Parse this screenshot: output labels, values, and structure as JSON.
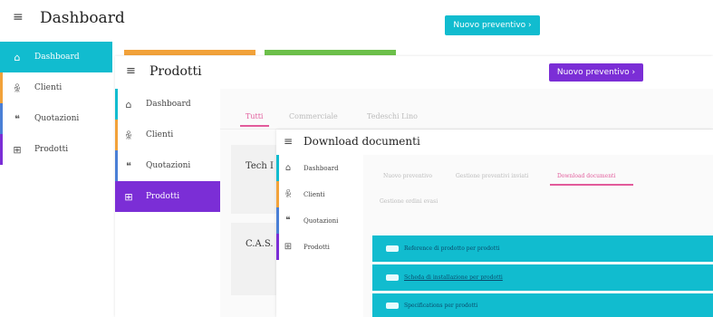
{
  "colors": {
    "teal": "#11bccf",
    "purple": "#7b2ed6",
    "pink": "#e25b9b",
    "orange": "#f2a23a",
    "green": "#6cc04a",
    "bluebar": "#4a7fd6"
  },
  "icons": {
    "menu": "hamburger-icon",
    "home": "home-icon",
    "clients": "user-icon",
    "quotes": "quote-icon",
    "products": "grid-icon",
    "document": "document-icon"
  },
  "win1": {
    "title": "Dashboard",
    "button": "Nuovo preventivo ›",
    "sidebar": [
      {
        "label": "Dashboard",
        "active": true
      },
      {
        "label": "Clienti",
        "active": false
      },
      {
        "label": "Quotazioni",
        "active": false
      },
      {
        "label": "Prodotti",
        "active": false
      }
    ]
  },
  "win2": {
    "title": "Prodotti",
    "button": "Nuovo preventivo ›",
    "sidebar": [
      {
        "label": "Dashboard",
        "active": false
      },
      {
        "label": "Clienti",
        "active": false
      },
      {
        "label": "Quotazioni",
        "active": false
      },
      {
        "label": "Prodotti",
        "active": true
      }
    ],
    "tabs": [
      "Tutti",
      "Commerciale",
      "Tedeschi Lino"
    ],
    "rows": [
      "Tech I",
      "C.A.S."
    ]
  },
  "win3": {
    "title": "Download documenti",
    "sidebar": [
      {
        "label": "Dashboard",
        "active": false
      },
      {
        "label": "Clienti",
        "active": false
      },
      {
        "label": "Quotazioni",
        "active": false
      },
      {
        "label": "Prodotti",
        "active": false
      }
    ],
    "tabs": [
      "Nuovo preventivo",
      "Gestione preventivi inviati",
      "Download documenti",
      "Gestione ordini evasi"
    ],
    "documents": [
      "Reference di prodotto per prodotti",
      "Scheda di installazione per prodotti",
      "Specifications per prodotti"
    ]
  }
}
